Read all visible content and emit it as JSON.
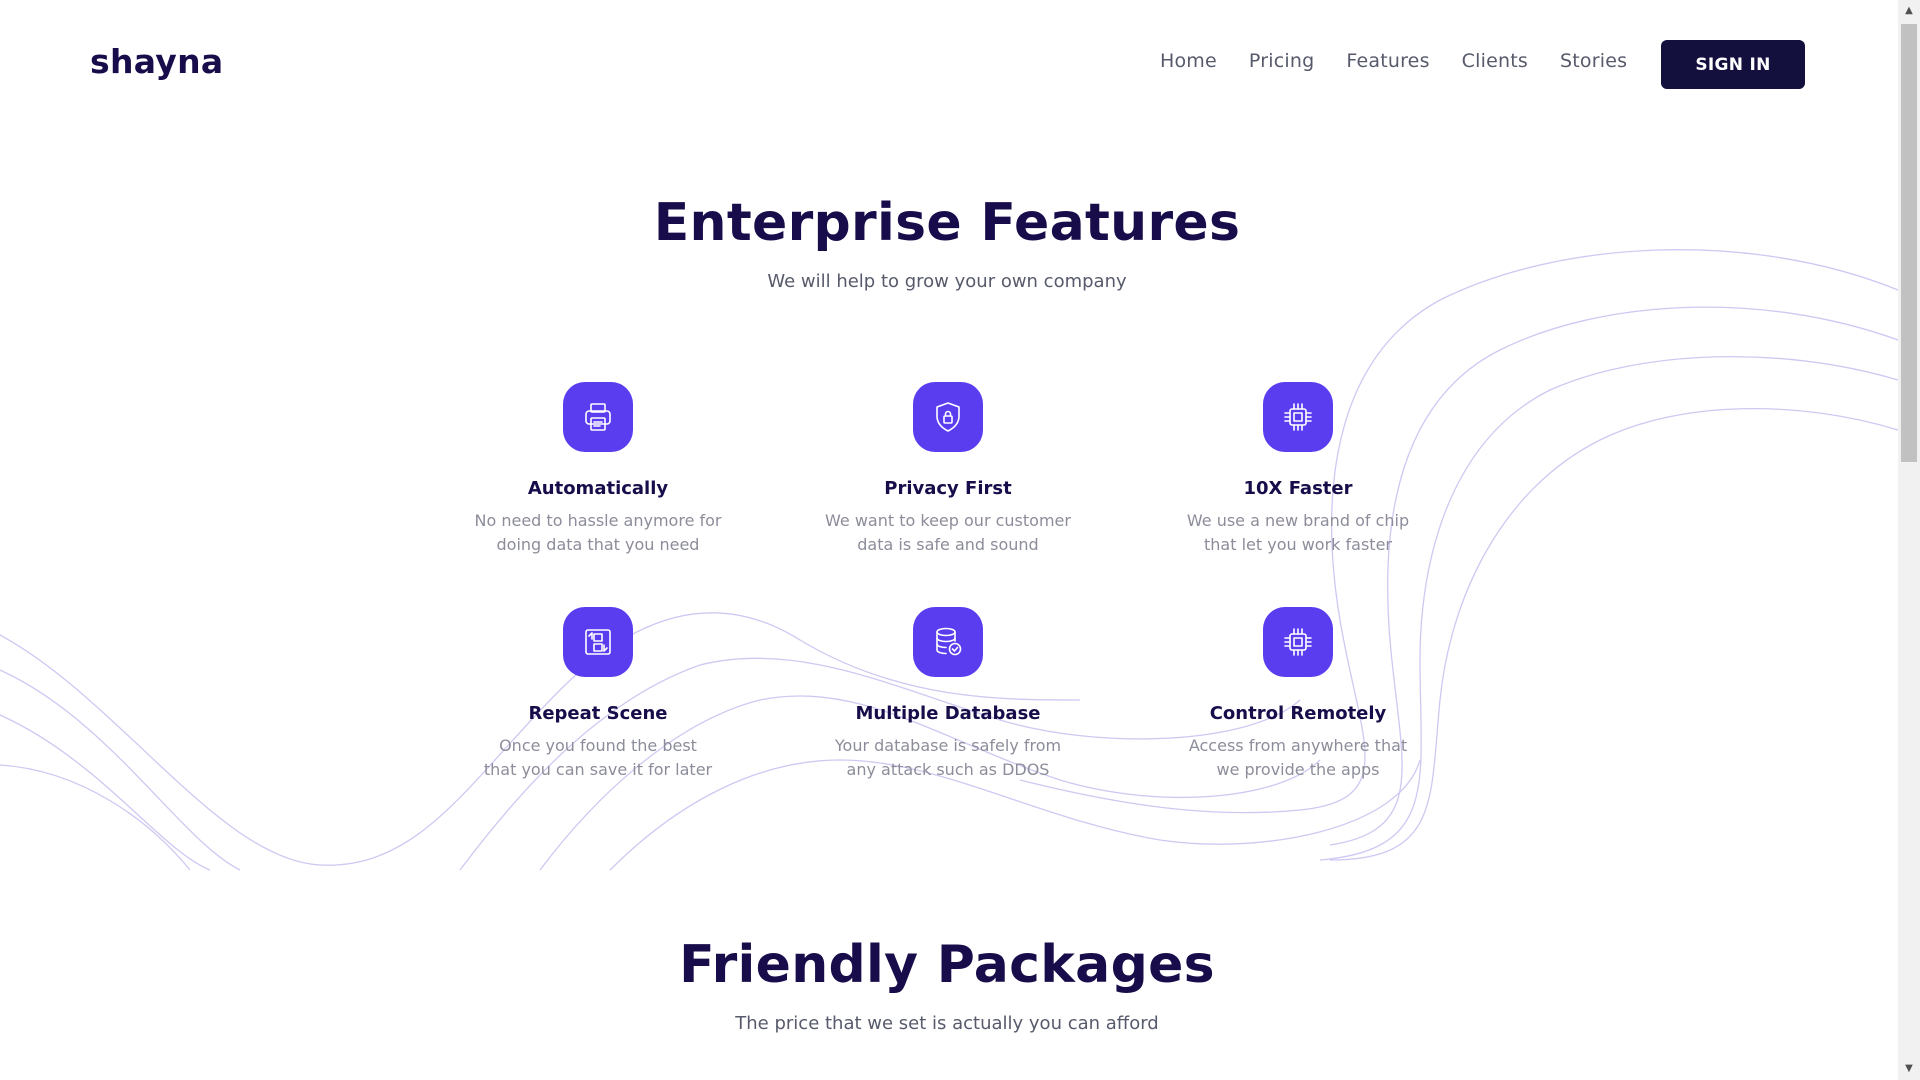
{
  "header": {
    "brand": "shayna",
    "nav": [
      "Home",
      "Pricing",
      "Features",
      "Clients",
      "Stories"
    ],
    "signin_label": "SIGN IN"
  },
  "features_section": {
    "title": "Enterprise Features",
    "subtitle": "We will help to grow your own company",
    "items": [
      {
        "title": "Automatically",
        "desc1": "No need to hassle anymore for",
        "desc2": "doing data that you need",
        "icon": "printer-icon"
      },
      {
        "title": "Privacy First",
        "desc1": "We want to keep our customer",
        "desc2": "data is safe and sound",
        "icon": "shield-lock-icon"
      },
      {
        "title": "10X Faster",
        "desc1": "We use a new brand of chip",
        "desc2": "that let you work faster",
        "icon": "chip-icon"
      },
      {
        "title": "Repeat Scene",
        "desc1": "Once you found the best",
        "desc2": "that you can save it for later",
        "icon": "repeat-layout-icon"
      },
      {
        "title": "Multiple Database",
        "desc1": "Your database is safely from",
        "desc2": "any attack such as DDOS",
        "icon": "database-check-icon"
      },
      {
        "title": "Control Remotely",
        "desc1": "Access from anywhere that",
        "desc2": "we provide the apps",
        "icon": "chip-icon"
      }
    ]
  },
  "packages_section": {
    "title": "Friendly Packages",
    "subtitle": "The price that we set is actually you can afford"
  },
  "colors": {
    "brand_dark": "#180d4a",
    "accent": "#5b3df0",
    "button_bg": "#14103e",
    "muted_text": "#8c8d9a"
  }
}
